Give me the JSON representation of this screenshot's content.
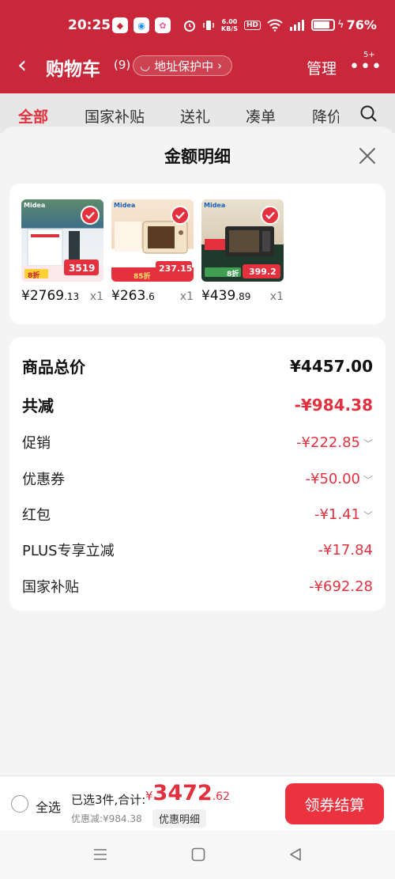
{
  "status": {
    "time": "20:25",
    "net_speed_top": "6.00",
    "net_speed_bottom": "KB/S",
    "hd": "HD",
    "battery_text": "76%",
    "battery_level": 0.76
  },
  "header": {
    "back_glyph": "‹",
    "title": "购物车",
    "count": "(9)",
    "address_badge": "地址保护中",
    "address_chevron": "›",
    "manage": "管理",
    "more_glyph": "•••",
    "more_badge": "5+"
  },
  "tabs": [
    {
      "label": "全部",
      "active": true
    },
    {
      "label": "国家补贴"
    },
    {
      "label": "送礼"
    },
    {
      "label": "凑单"
    },
    {
      "label": "降价"
    }
  ],
  "sheet": {
    "title": "金额明细",
    "products": [
      {
        "price_int": "¥2769",
        "price_dec": ".13",
        "qty": "x1",
        "thumb_text": "3519",
        "thumb_badge": "8折"
      },
      {
        "price_int": "¥263",
        "price_dec": ".6",
        "qty": "x1",
        "thumb_text": "237.15",
        "thumb_badge": "85折"
      },
      {
        "price_int": "¥439",
        "price_dec": ".89",
        "qty": "x1",
        "thumb_text": "399.2",
        "thumb_badge": "8折"
      }
    ],
    "thumb_brand": "Midea",
    "summary": [
      {
        "label": "商品总价",
        "value": "¥4457.00",
        "bold": true,
        "black": true
      },
      {
        "label": "共减",
        "value": "-¥984.38",
        "bold": true
      },
      {
        "label": "促销",
        "value": "-¥222.85",
        "expand": true
      },
      {
        "label": "优惠券",
        "value": "-¥50.00",
        "expand": true
      },
      {
        "label": "红包",
        "value": "-¥1.41",
        "expand": true
      },
      {
        "label": "PLUS专享立减",
        "value": "-¥17.84"
      },
      {
        "label": "国家补贴",
        "value": "-¥692.28"
      }
    ]
  },
  "bottom": {
    "select_all": "全选",
    "selected_info": "已选3件,合计:",
    "total_currency": "¥",
    "total_int": "3472",
    "total_dec": ".62",
    "discount": "优惠减:¥984.38",
    "detail_button": "优惠明细",
    "pay_button": "领券结算"
  },
  "colors": {
    "header_red": "#c9283a",
    "accent_red": "#e3303e",
    "pay_button": "#eb3340"
  }
}
